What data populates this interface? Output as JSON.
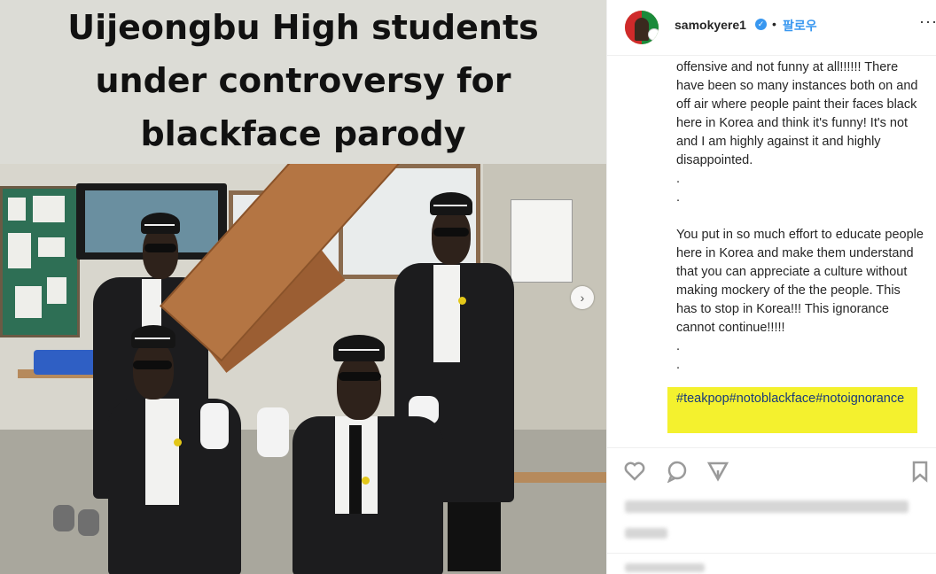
{
  "post_image": {
    "headline_lines": [
      "Uijeongbu High students",
      "under controversy for",
      "blackface parody"
    ]
  },
  "carousel": {
    "next_icon": "chevron-right-icon",
    "next_glyph": "›"
  },
  "header": {
    "username": "samokyere1",
    "verified_glyph": "✓",
    "separator": "•",
    "follow_label": "팔로우",
    "more_glyph": "···"
  },
  "caption": {
    "paragraph1": "offensive and not funny at all!!!!!! There have been so many instances both on and off air where people paint their faces black here in Korea and think it's funny! It's not and I am highly against it and highly disappointed.",
    "dot1": ".",
    "dot2": ".",
    "paragraph2": "You put in so much effort to educate people here in Korea and make them understand that you can appreciate a culture without making mockery of the the people. This has to stop in Korea!!! This ignorance cannot continue!!!!!",
    "dot3": ".",
    "dot4": ".",
    "hashtags": "#teakpop#notoblackface#notoignorance"
  },
  "colors": {
    "link_blue": "#3897f0",
    "highlight_yellow": "#f4f12e",
    "hashtag_text": "#1a3b7a"
  },
  "actions": [
    "heart-icon",
    "comment-icon",
    "share-icon",
    "bookmark-icon"
  ]
}
